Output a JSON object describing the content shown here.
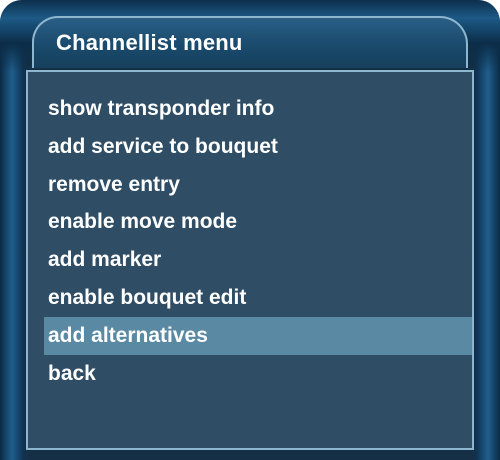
{
  "menu": {
    "title": "Channellist menu",
    "items": [
      {
        "label": "show transponder info"
      },
      {
        "label": "add service to bouquet"
      },
      {
        "label": "remove entry"
      },
      {
        "label": "enable move mode"
      },
      {
        "label": "add marker"
      },
      {
        "label": "enable bouquet edit"
      },
      {
        "label": "add alternatives",
        "selected": true
      },
      {
        "label": "back"
      }
    ],
    "selected_index": 6
  },
  "colors": {
    "panel_background": "#2f4e66",
    "selection_highlight": "#5a8aa3",
    "frame": "#1f5f8c",
    "text": "#ffffff"
  }
}
